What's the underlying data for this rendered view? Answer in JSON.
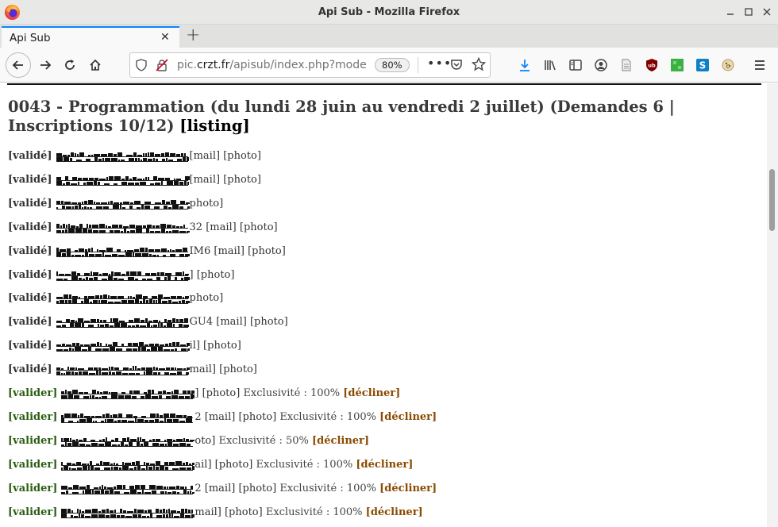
{
  "window": {
    "title": "Api Sub - Mozilla Firefox"
  },
  "tabs": [
    {
      "label": "Api Sub"
    }
  ],
  "urlbar": {
    "prefix": "pic.",
    "host": "crzt.fr",
    "path": "/apisub/index.php?mode",
    "zoom": "80%"
  },
  "page": {
    "title_main": "0043 - Programmation (du lundi 28 juin au vendredi 2 juillet) (Demandes 6 | Inscriptions 10/12)",
    "title_link": "[listing]"
  },
  "rows": [
    {
      "status": "[validé]",
      "tail": "[mail] [photo]",
      "exclusivity": "",
      "decline": ""
    },
    {
      "status": "[validé]",
      "tail": "[mail] [photo]",
      "exclusivity": "",
      "decline": ""
    },
    {
      "status": "[validé]",
      "tail": "photo]",
      "exclusivity": "",
      "decline": ""
    },
    {
      "status": "[validé]",
      "tail": "32 [mail] [photo]",
      "exclusivity": "",
      "decline": ""
    },
    {
      "status": "[validé]",
      "tail": "IM6 [mail] [photo]",
      "exclusivity": "",
      "decline": ""
    },
    {
      "status": "[validé]",
      "tail": "] [photo]",
      "exclusivity": "",
      "decline": ""
    },
    {
      "status": "[validé]",
      "tail": "photo]",
      "exclusivity": "",
      "decline": ""
    },
    {
      "status": "[validé]",
      "tail": "GU4 [mail] [photo]",
      "exclusivity": "",
      "decline": ""
    },
    {
      "status": "[validé]",
      "tail": "il] [photo]",
      "exclusivity": "",
      "decline": ""
    },
    {
      "status": "[validé]",
      "tail": "mail] [photo]",
      "exclusivity": "",
      "decline": ""
    },
    {
      "status": "[valider]",
      "tail": "] [photo]",
      "exclusivity": "Exclusivité : 100%",
      "decline": "[décliner]"
    },
    {
      "status": "[valider]",
      "tail": "2 [mail] [photo]",
      "exclusivity": "Exclusivité : 100%",
      "decline": "[décliner]"
    },
    {
      "status": "[valider]",
      "tail": "oto]",
      "exclusivity": "Exclusivité : 50%",
      "decline": "[décliner]"
    },
    {
      "status": "[valider]",
      "tail": "ail] [photo]",
      "exclusivity": "Exclusivité : 100%",
      "decline": "[décliner]"
    },
    {
      "status": "[valider]",
      "tail": "2 [mail] [photo]",
      "exclusivity": "Exclusivité : 100%",
      "decline": "[décliner]"
    },
    {
      "status": "[valider]",
      "tail": "mail] [photo]",
      "exclusivity": "Exclusivité : 100%",
      "decline": "[décliner]"
    }
  ],
  "colors": {
    "accent": "#0a84ff",
    "validated": "#333333",
    "to_validate": "#2b5e12",
    "decline": "#8a4a00"
  }
}
